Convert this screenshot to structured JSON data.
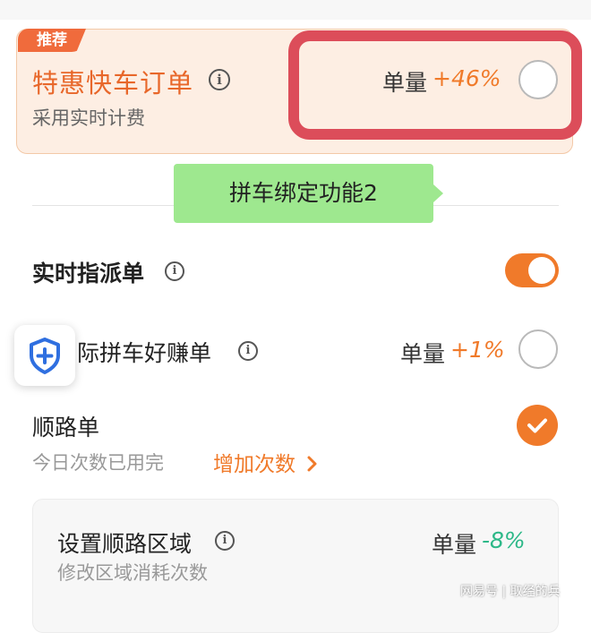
{
  "recommended": {
    "badge": "推荐",
    "title": "特惠快车订单",
    "subtitle": "采用实时计费",
    "volume_label": "单量",
    "volume_value": "+46%"
  },
  "tip": {
    "text": "拼车绑定功能2"
  },
  "realtime": {
    "title": "实时指派单",
    "toggle_on": true
  },
  "carpool": {
    "title": "际拼车好赚单",
    "volume_label": "单量",
    "volume_value": "+1%"
  },
  "along_route": {
    "title": "顺路单",
    "quota_text": "今日次数已用完",
    "add_link": "增加次数",
    "checked": true
  },
  "region": {
    "title": "设置顺路区域",
    "subtitle": "修改区域消耗次数",
    "volume_label": "单量",
    "volume_value": "-8%"
  },
  "watermark": "网易号 | 取经的兵",
  "colors": {
    "accent": "#f07a2a",
    "highlight_border": "#dc4d5a",
    "tip_bg": "#9ee88f",
    "positive": "#2db888"
  },
  "icons": {
    "info": "info-icon",
    "shield": "shield-plus-icon",
    "check": "check-icon",
    "chevron": "chevron-right-icon"
  }
}
